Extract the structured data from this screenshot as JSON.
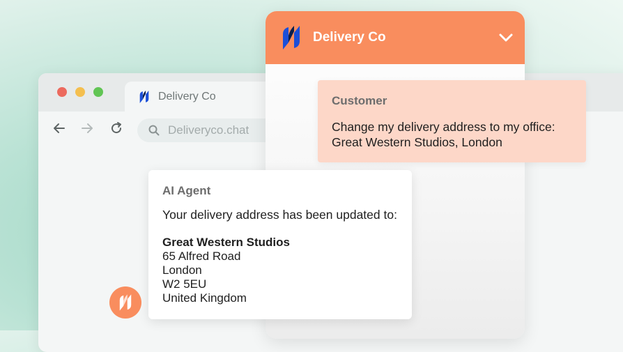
{
  "browser": {
    "tab_title": "Delivery Co",
    "url": "Deliveryco.chat"
  },
  "widget": {
    "title": "Delivery Co"
  },
  "customer_message": {
    "sender": "Customer",
    "text": "Change my delivery address to my office: Great Western Studios, London"
  },
  "agent_message": {
    "sender": "AI Agent",
    "text": "Your delivery address has been updated to:",
    "address": {
      "name": "Great Western Studios",
      "line1": "65 Alfred Road",
      "line2": "London",
      "line3": "W2 5EU",
      "line4": "United Kingdom"
    }
  },
  "colors": {
    "brand_orange": "#f98d5e",
    "customer_bubble": "#fdd7c8",
    "logo_blue": "#1b4fd8",
    "logo_navy": "#0b1f4d"
  },
  "icons": [
    "back-arrow-icon",
    "forward-arrow-icon",
    "reload-icon",
    "search-icon",
    "chevron-down-icon",
    "brand-logo-icon"
  ]
}
